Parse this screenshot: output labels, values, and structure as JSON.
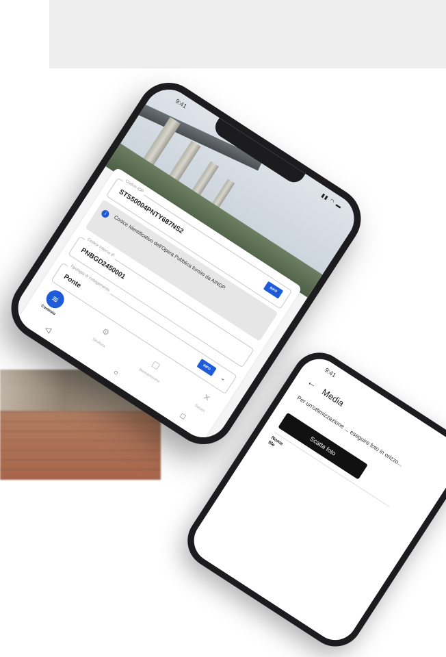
{
  "phone_main": {
    "status_time": "9:41",
    "status_icons": "▮▮ ◠ ▬",
    "fields": {
      "code_label": "Codice IOP",
      "code_value": "STS50004PNTY687NS2",
      "code_info_button": "INFO",
      "code_note": "Codice Identificativo dell'Opera Pubblica fornito da AINOP.",
      "internal_label": "Codice Interno IF",
      "internal_value": "PNBGD2450001",
      "type_label": "Tipologia di collegamento",
      "type_value": "Ponte",
      "type_info_button": "INFO"
    },
    "tabs": [
      {
        "label": "Contesto",
        "icon": "layers-icon",
        "glyph": "≋"
      },
      {
        "label": "Struttura",
        "icon": "structure-icon",
        "glyph": "⚙"
      },
      {
        "label": "Manutenzione",
        "icon": "document-icon",
        "glyph": "▢"
      },
      {
        "label": "Servizi",
        "icon": "tools-icon",
        "glyph": "✕"
      }
    ],
    "nav": {
      "back": "◁",
      "home": "○",
      "recent": "□"
    }
  },
  "phone_secondary": {
    "status_time": "9:41",
    "back_glyph": "←",
    "title": "Media",
    "description": "Per un'ottimizzazione ... eseguire foto in orizzo...",
    "take_photo_button": "Scatta foto",
    "file_label": "Nome file"
  },
  "colors": {
    "accent": "#1e5bd6",
    "phone_body": "#1c1c1e",
    "button_dark": "#111111"
  }
}
